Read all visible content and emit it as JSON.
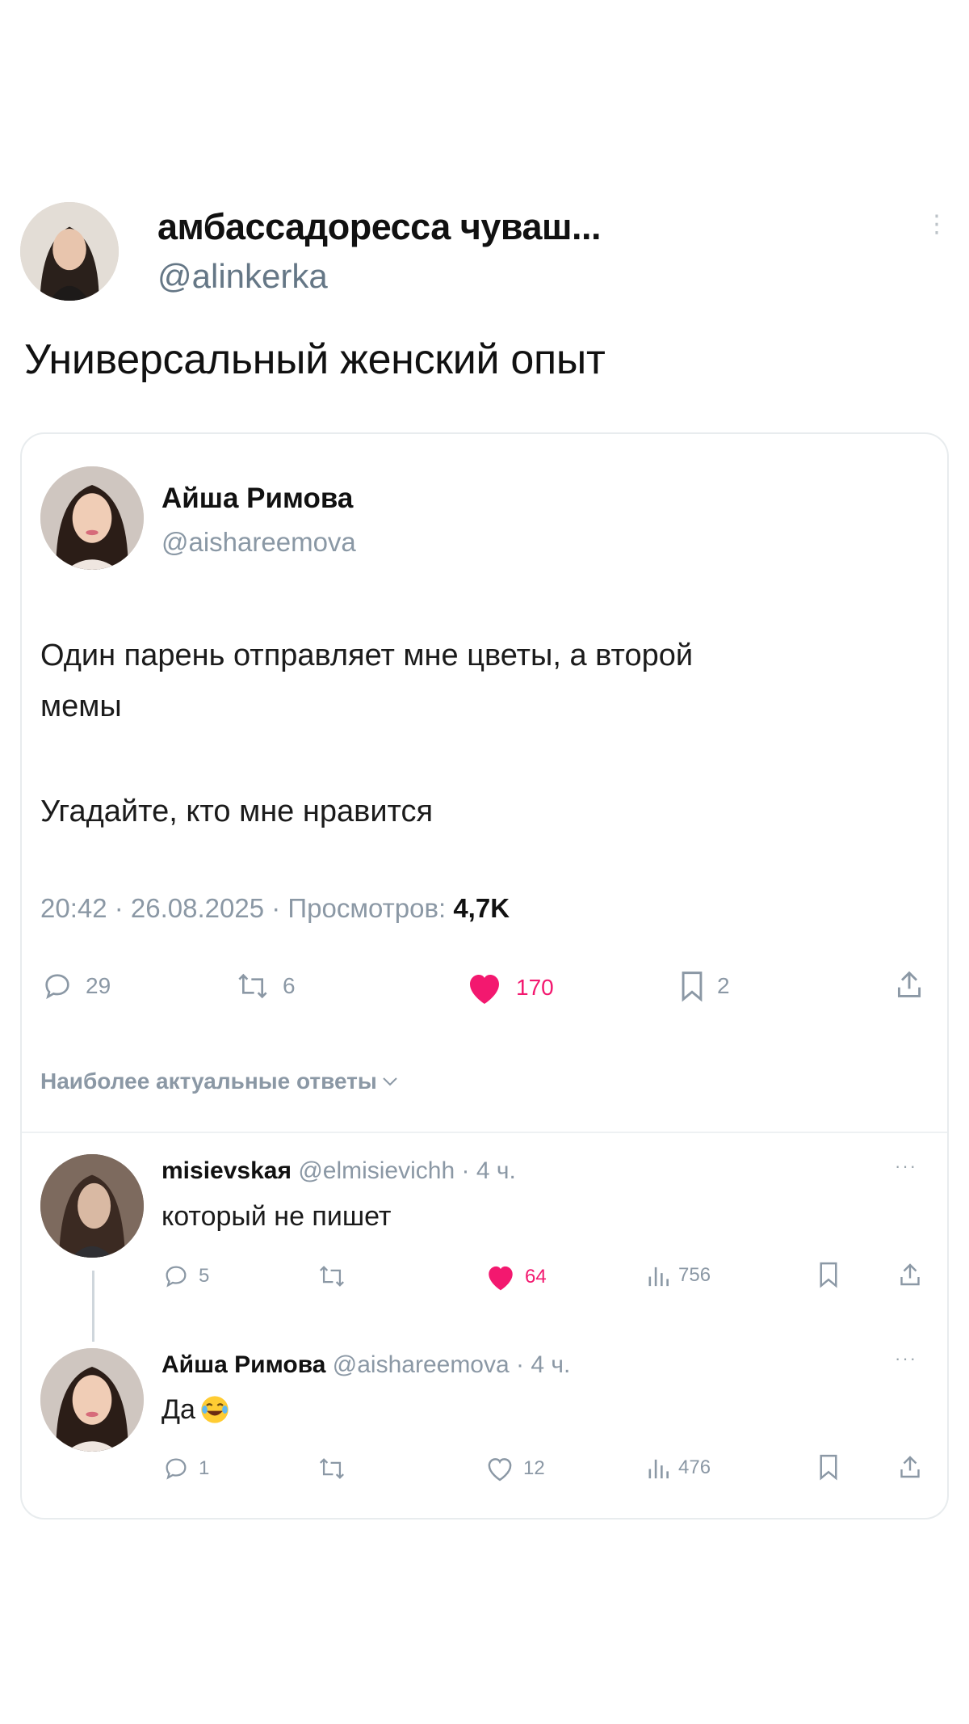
{
  "tweet": {
    "author_name": "амбассадоресса чуваш...",
    "author_handle": "@alinkerka",
    "text": "Универсальный женский опыт"
  },
  "quoted": {
    "author_name": "Айша Римова",
    "author_handle": "@aishareemova",
    "text_line1": "Один парень отправляет мне цветы, а второй",
    "text_line2": "мемы",
    "text_line3": "Угадайте, кто мне нравится",
    "meta_prefix": "20:42 · 26.08.2025 · Просмотров: ",
    "views": "4,7K",
    "actions": {
      "replies": "29",
      "reposts": "6",
      "likes": "170",
      "bookmarks": "2"
    },
    "sort_label": "Наиболее актуальные ответы"
  },
  "replies": [
    {
      "name": "misievskaя",
      "handle": "@elmisievichh",
      "time": "· 4 ч.",
      "text": "который не пишет",
      "replies": "5",
      "likes": "64",
      "views": "756"
    },
    {
      "name": "Айша Римова",
      "handle": "@aishareemova",
      "time": "· 4 ч.",
      "text": "Да",
      "replies": "1",
      "likes": "12",
      "views": "476"
    }
  ],
  "colors": {
    "like_pink": "#f3186f",
    "muted_gray": "#8b98a5",
    "text_dark": "#0f1419"
  }
}
